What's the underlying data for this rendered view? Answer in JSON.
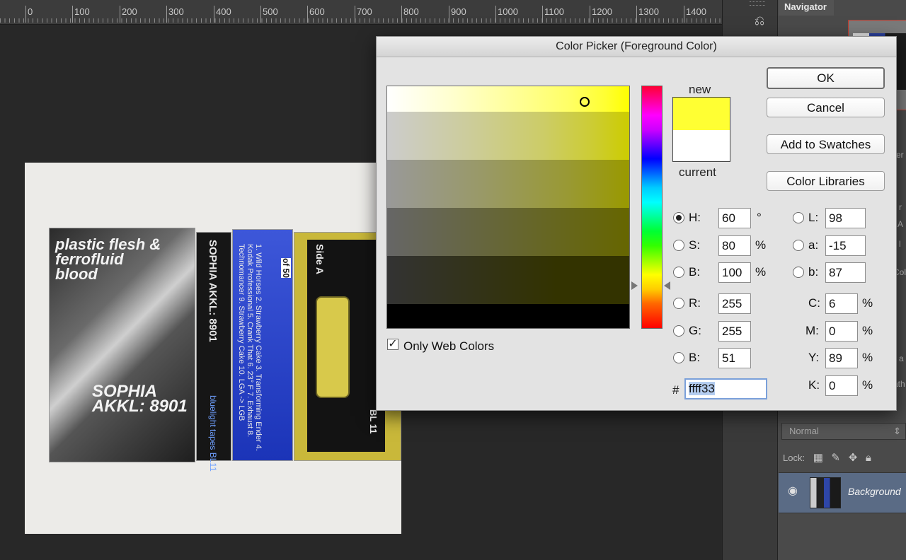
{
  "ruler": {
    "ticks": [
      "0",
      "100",
      "200",
      "300",
      "400",
      "500",
      "600",
      "700",
      "800",
      "900",
      "1000",
      "1100",
      "1200",
      "1300",
      "1400"
    ]
  },
  "navigator": {
    "tab_label": "Navigator"
  },
  "layers": {
    "blend_mode": "Normal",
    "lock_label": "Lock:",
    "layer_name": "Background",
    "edge_labels": [
      "er",
      "r",
      "l",
      "A",
      "Col",
      "a",
      "ath"
    ]
  },
  "photo": {
    "tape1_title": "plastic flesh & ferrofluid blood",
    "tape1_artist": "SOPHIA AKKL: 8901",
    "tape2_spine": "SOPHIA AKKL: 8901",
    "tape2_label": "bluelight tapes BL11",
    "tape3_tracklist": "1. Wild Horses 2. Strawberry Cake 3. Transforming Ender 4. Kodak Professional 5. Crank That 6. 23° F 7. Exhaust 8. Technomancer 9. Strawberry Cake 10. LGA -> LGB",
    "tape3_edition": "of 50",
    "tape4_side": "Side A",
    "tape4_code": "BL 11"
  },
  "dialog": {
    "title": "Color Picker (Foreground Color)",
    "label_new": "new",
    "label_current": "current",
    "swatch_new_color": "#ffff33",
    "swatch_current_color": "#ffffff",
    "buttons": {
      "ok": "OK",
      "cancel": "Cancel",
      "add_to_swatches": "Add to Swatches",
      "color_libraries": "Color Libraries"
    },
    "hsb": {
      "h": {
        "label": "H:",
        "value": "60",
        "unit": "°"
      },
      "s": {
        "label": "S:",
        "value": "80",
        "unit": "%"
      },
      "b": {
        "label": "B:",
        "value": "100",
        "unit": "%"
      }
    },
    "rgb": {
      "r": {
        "label": "R:",
        "value": "255"
      },
      "g": {
        "label": "G:",
        "value": "255"
      },
      "b": {
        "label": "B:",
        "value": "51"
      }
    },
    "lab": {
      "l": {
        "label": "L:",
        "value": "98"
      },
      "a": {
        "label": "a:",
        "value": "-15"
      },
      "b": {
        "label": "b:",
        "value": "87"
      }
    },
    "cmyk": {
      "c": {
        "label": "C:",
        "value": "6",
        "unit": "%"
      },
      "m": {
        "label": "M:",
        "value": "0",
        "unit": "%"
      },
      "y": {
        "label": "Y:",
        "value": "89",
        "unit": "%"
      },
      "k": {
        "label": "K:",
        "value": "0",
        "unit": "%"
      }
    },
    "hex_label": "#",
    "hex_value": "ffff33",
    "only_web_colors_label": "Only Web Colors",
    "only_web_colors_checked": true,
    "selected_mode": "H"
  }
}
